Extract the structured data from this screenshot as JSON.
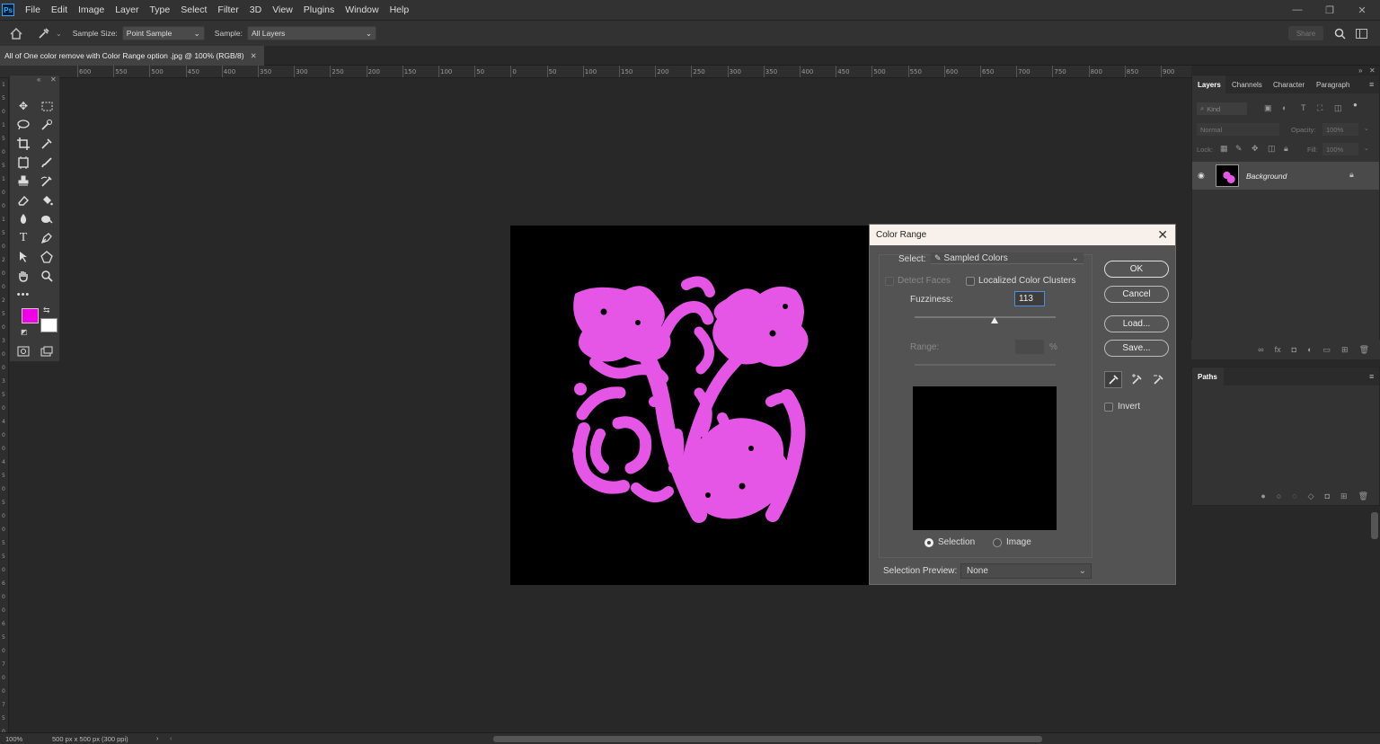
{
  "app": {
    "logo_text": "Ps"
  },
  "menu": [
    "File",
    "Edit",
    "Image",
    "Layer",
    "Type",
    "Select",
    "Filter",
    "3D",
    "View",
    "Plugins",
    "Window",
    "Help"
  ],
  "options_bar": {
    "sample_size_label": "Sample Size:",
    "sample_size_value": "Point Sample",
    "sample_label": "Sample:",
    "sample_value": "All Layers",
    "share_label": "Share"
  },
  "document_tab": {
    "title": "All of One color remove with Color Range option .jpg @ 100% (RGB/8)"
  },
  "ruler_top_ticks": [
    "600",
    "550",
    "500",
    "450",
    "400",
    "350",
    "300",
    "250",
    "200",
    "150",
    "100",
    "50",
    "0",
    "50",
    "100",
    "150",
    "200",
    "250",
    "300",
    "350",
    "400",
    "450",
    "500",
    "550",
    "600",
    "650",
    "700",
    "750",
    "800",
    "850",
    "900"
  ],
  "ruler_left_ticks": [
    "1",
    "5",
    "0",
    "1",
    "5",
    "0",
    "5",
    "1",
    "0",
    "0",
    "1",
    "5",
    "0",
    "2",
    "0",
    "0",
    "2",
    "5",
    "0",
    "3",
    "0",
    "0",
    "3",
    "5",
    "0",
    "4",
    "0",
    "0",
    "4",
    "5",
    "0",
    "5",
    "0",
    "0",
    "5",
    "5",
    "0",
    "6",
    "0",
    "0",
    "6",
    "5",
    "0",
    "7",
    "0",
    "0",
    "7",
    "5",
    "0"
  ],
  "colors": {
    "foreground": "#f000e8",
    "background": "#ffffff",
    "artwork": "#e556e6",
    "canvas": "#000000"
  },
  "toolbar_icons": [
    "move-tool",
    "marquee-tool",
    "lasso-tool",
    "quick-select-tool",
    "crop-tool",
    "eyedropper-tool",
    "frame-tool",
    "brush-tool",
    "healing-tool",
    "clone-stamp-tool",
    "history-brush-tool",
    "eraser-tool",
    "paint-bucket-tool",
    "blur-tool",
    "dodge-tool",
    "type-tool",
    "pen-tool",
    "path-select-tool",
    "shape-tool",
    "hand-tool",
    "zoom-tool",
    "more-tools"
  ],
  "color_range_dialog": {
    "title": "Color Range",
    "select_label": "Select:",
    "select_value": "Sampled Colors",
    "detect_faces_label": "Detect Faces",
    "localized_label": "Localized Color Clusters",
    "fuzziness_label": "Fuzziness:",
    "fuzziness_value": "113",
    "fuzziness_max": 200,
    "range_label": "Range:",
    "range_unit": "%",
    "selection_label": "Selection",
    "image_label": "Image",
    "selection_preview_label": "Selection Preview:",
    "selection_preview_value": "None",
    "ok_label": "OK",
    "cancel_label": "Cancel",
    "load_label": "Load...",
    "save_label": "Save...",
    "invert_label": "Invert"
  },
  "layers_panel": {
    "tabs": [
      "Layers",
      "Channels",
      "Character",
      "Paragraph"
    ],
    "kind_label": "Kind",
    "blend_mode": "Normal",
    "opacity_label": "Opacity:",
    "opacity_value": "100%",
    "lock_label": "Lock:",
    "fill_label": "Fill:",
    "fill_value": "100%",
    "layer_name": "Background"
  },
  "paths_panel": {
    "title": "Paths"
  },
  "status": {
    "zoom": "100%",
    "doc_info": "500 px x 500 px (300 ppi)"
  }
}
